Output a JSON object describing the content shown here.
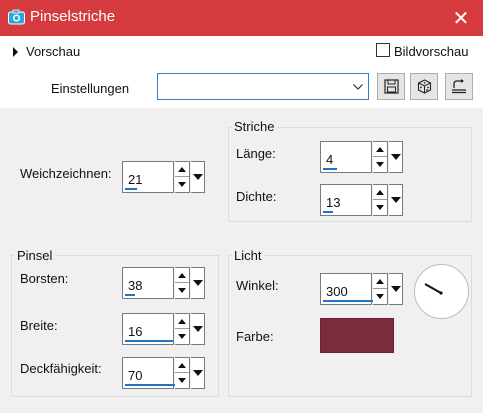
{
  "window": {
    "title": "Pinselstriche",
    "close_glyph": "✕"
  },
  "header": {
    "preview_label": "Vorschau",
    "bild_preview_label": "Bildvorschau",
    "bild_preview_checked": false,
    "settings_label": "Einstellungen",
    "settings_value": "",
    "buttons": [
      {
        "icon": "save-icon"
      },
      {
        "icon": "dice-icon"
      },
      {
        "icon": "reset-icon"
      }
    ]
  },
  "fields": {
    "weichzeichnen": {
      "label": "Weichzeichnen:",
      "value": "21"
    }
  },
  "striche": {
    "title": "Striche",
    "laenge": {
      "label": "Länge:",
      "value": "4"
    },
    "dichte": {
      "label": "Dichte:",
      "value": "13"
    }
  },
  "pinsel": {
    "title": "Pinsel",
    "borsten": {
      "label": "Borsten:",
      "value": "38"
    },
    "breite": {
      "label": "Breite:",
      "value": "16"
    },
    "deckfaehigkeit": {
      "label": "Deckfähigkeit:",
      "value": "70"
    }
  },
  "licht": {
    "title": "Licht",
    "winkel": {
      "label": "Winkel:",
      "value": "300"
    },
    "farbe": {
      "label": "Farbe:",
      "color": "#7a2b3d"
    }
  },
  "colors": {
    "titlebar": "#d43a3e",
    "accent": "#1f74c4",
    "focus_border": "#2f7fcf"
  }
}
